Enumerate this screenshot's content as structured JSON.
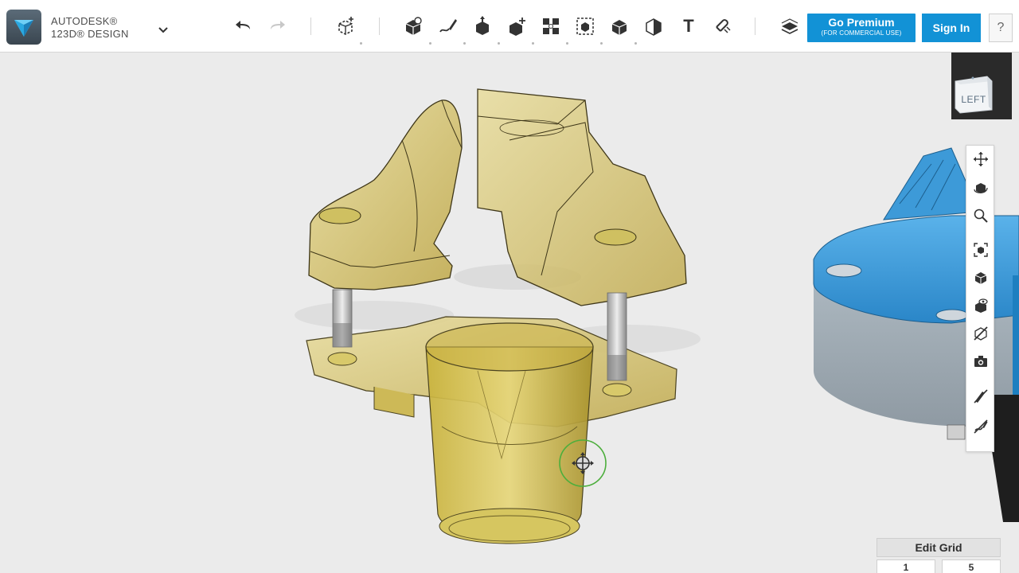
{
  "app": {
    "brand_line1": "AUTODESK®",
    "brand_line2": "123D® DESIGN"
  },
  "toolbar": {
    "undo_icon": "undo-arrow-icon",
    "redo_icon": "redo-arrow-icon",
    "text_tool_label": "T",
    "premium_label": "Go Premium",
    "premium_sublabel": "(FOR COMMERCIAL USE)",
    "signin_label": "Sign In",
    "help_label": "?"
  },
  "viewcube": {
    "face_label": "LEFT"
  },
  "nav_tools": [
    "pan-icon",
    "orbit-icon",
    "zoom-icon",
    "fit-icon",
    "perspective-icon",
    "visibility-icon",
    "materials-outline-icon",
    "camera-icon",
    "hide-sketches-icon",
    "hide-meshes-icon"
  ],
  "grid": {
    "title": "Edit Grid",
    "value_left": "1",
    "value_right": "5"
  },
  "colors": {
    "accent_blue": "#1292d6",
    "model_yellow": "#c9b649",
    "model_blue": "#3d9ad8"
  }
}
